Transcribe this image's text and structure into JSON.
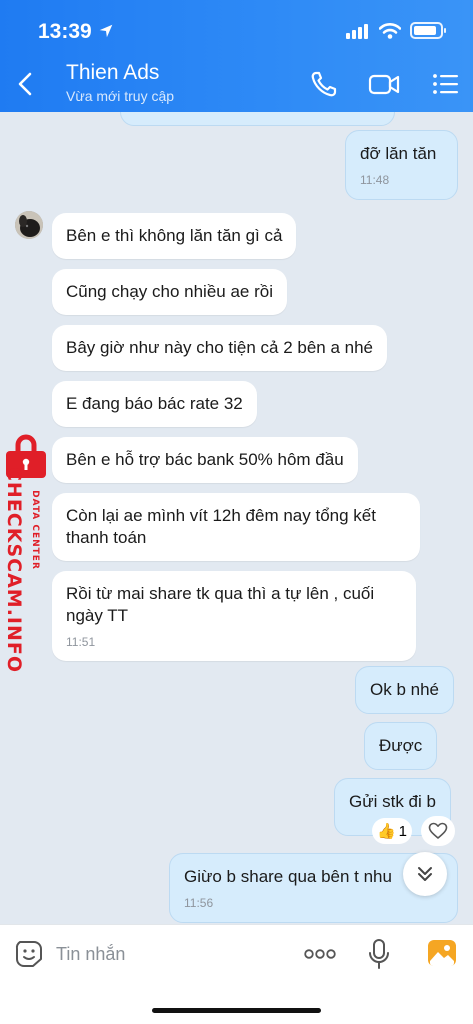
{
  "status_bar": {
    "time": "13:39"
  },
  "header": {
    "contact_name": "Thien Ads",
    "contact_status": "Vừa mới truy cập"
  },
  "messages": [
    {
      "direction": "out",
      "text": "đỡ lăn tăn",
      "time": "11:48"
    },
    {
      "direction": "in",
      "text": "Bên e thì không lăn tăn gì cả"
    },
    {
      "direction": "in",
      "text": "Cũng chạy cho nhiều ae rồi"
    },
    {
      "direction": "in",
      "text": "Bây giờ như này cho tiện cả 2 bên a nhé"
    },
    {
      "direction": "in",
      "text": "E đang báo bác rate 32"
    },
    {
      "direction": "in",
      "text": "Bên e hỗ trợ bác bank 50% hôm đầu"
    },
    {
      "direction": "in",
      "text": "Còn lại ae mình vít 12h đêm nay tổng kết thanh toán"
    },
    {
      "direction": "in",
      "text": "Rồi từ mai share tk qua thì a tự lên , cuối ngày TT",
      "time": "11:51"
    },
    {
      "direction": "out",
      "text": "Ok b nhé"
    },
    {
      "direction": "out",
      "text": "Được"
    },
    {
      "direction": "out",
      "text": "Gửi stk đi b",
      "reaction": {
        "emoji": "👍",
        "count": "1"
      }
    },
    {
      "direction": "out",
      "text": "Giừo b share qua bên t nhu",
      "time": "11:56"
    }
  ],
  "watermark": {
    "brand": "CHECKSCAM.INFO",
    "tagline": "DATA CENTER"
  },
  "input_bar": {
    "placeholder": "Tin nhắn",
    "more_label": "ooo"
  }
}
